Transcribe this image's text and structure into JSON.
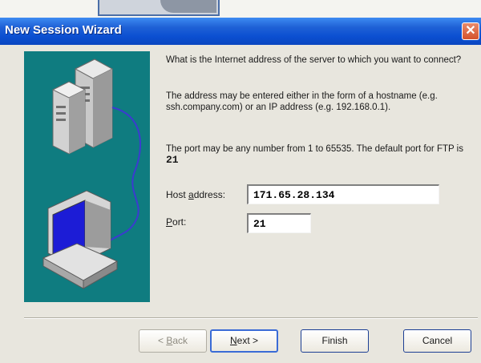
{
  "window": {
    "title": "New Session Wizard"
  },
  "content": {
    "question": "What is the Internet address of the          server to which you want to connect?",
    "address_help": "The address may be entered either in the form of a hostname (e.g. ssh.company.com) or an IP address (e.g. 192.168.0.1).",
    "port_help": "The port may be any number from 1 to 65535.  The default port for   FTP is ",
    "default_port": "21"
  },
  "fields": {
    "host_label_pre": "Host ",
    "host_label_accel": "a",
    "host_label_post": "ddress:",
    "host_value": "171.65.28.134",
    "port_label_accel": "P",
    "port_label_post": "ort:",
    "port_value": "21"
  },
  "buttons": {
    "back_pre": "< ",
    "back_accel": "B",
    "back_post": "ack",
    "next_accel": "N",
    "next_post": "ext >",
    "finish": "Finish",
    "cancel": "Cancel"
  },
  "icons": {
    "close": "close-icon",
    "illustration": "server-client-illustration"
  },
  "colors": {
    "titlebar": "#0b4fd1",
    "illustration_bg": "#0f7c80",
    "close_button": "#d5522c"
  }
}
